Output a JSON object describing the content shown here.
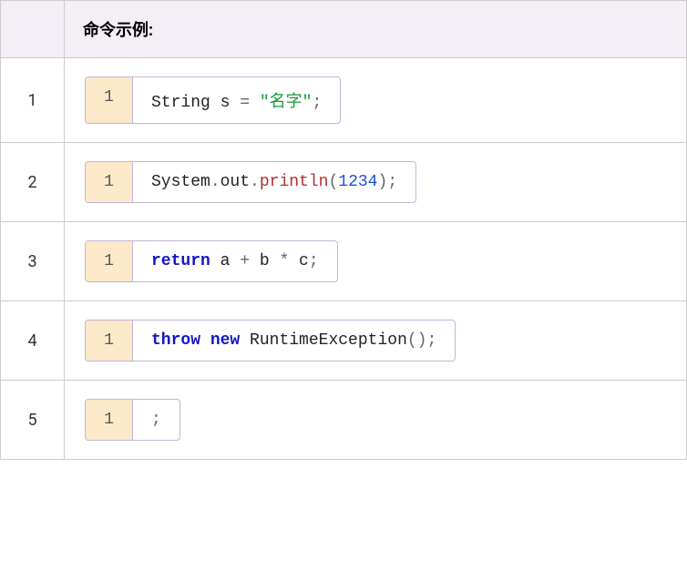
{
  "table": {
    "header_label": "命令示例:",
    "rows": [
      {
        "num": "1",
        "code_line": "1",
        "tokens": [
          {
            "t": "String s ",
            "cls": "tok-type"
          },
          {
            "t": "=",
            "cls": "tok-punct"
          },
          {
            "t": " ",
            "cls": ""
          },
          {
            "t": "\"名字\"",
            "cls": "tok-string"
          },
          {
            "t": ";",
            "cls": "tok-punct"
          }
        ]
      },
      {
        "num": "2",
        "code_line": "1",
        "tokens": [
          {
            "t": "System",
            "cls": "tok-type"
          },
          {
            "t": ".",
            "cls": "tok-punct"
          },
          {
            "t": "out",
            "cls": "tok-type"
          },
          {
            "t": ".",
            "cls": "tok-punct"
          },
          {
            "t": "println",
            "cls": "tok-method"
          },
          {
            "t": "(",
            "cls": "tok-punct"
          },
          {
            "t": "1234",
            "cls": "tok-number"
          },
          {
            "t": ")",
            "cls": "tok-punct"
          },
          {
            "t": ";",
            "cls": "tok-punct"
          }
        ]
      },
      {
        "num": "3",
        "code_line": "1",
        "tokens": [
          {
            "t": "return",
            "cls": "tok-keyword"
          },
          {
            "t": " a ",
            "cls": ""
          },
          {
            "t": "+",
            "cls": "tok-punct"
          },
          {
            "t": " b ",
            "cls": ""
          },
          {
            "t": "*",
            "cls": "tok-punct"
          },
          {
            "t": " c",
            "cls": ""
          },
          {
            "t": ";",
            "cls": "tok-punct"
          }
        ]
      },
      {
        "num": "4",
        "code_line": "1",
        "tokens": [
          {
            "t": "throw",
            "cls": "tok-keyword"
          },
          {
            "t": " ",
            "cls": ""
          },
          {
            "t": "new",
            "cls": "tok-keyword"
          },
          {
            "t": " RuntimeException",
            "cls": "tok-type"
          },
          {
            "t": "()",
            "cls": "tok-punct"
          },
          {
            "t": ";",
            "cls": "tok-punct"
          }
        ]
      },
      {
        "num": "5",
        "code_line": "1",
        "tokens": [
          {
            "t": ";",
            "cls": "tok-punct"
          }
        ]
      }
    ]
  }
}
